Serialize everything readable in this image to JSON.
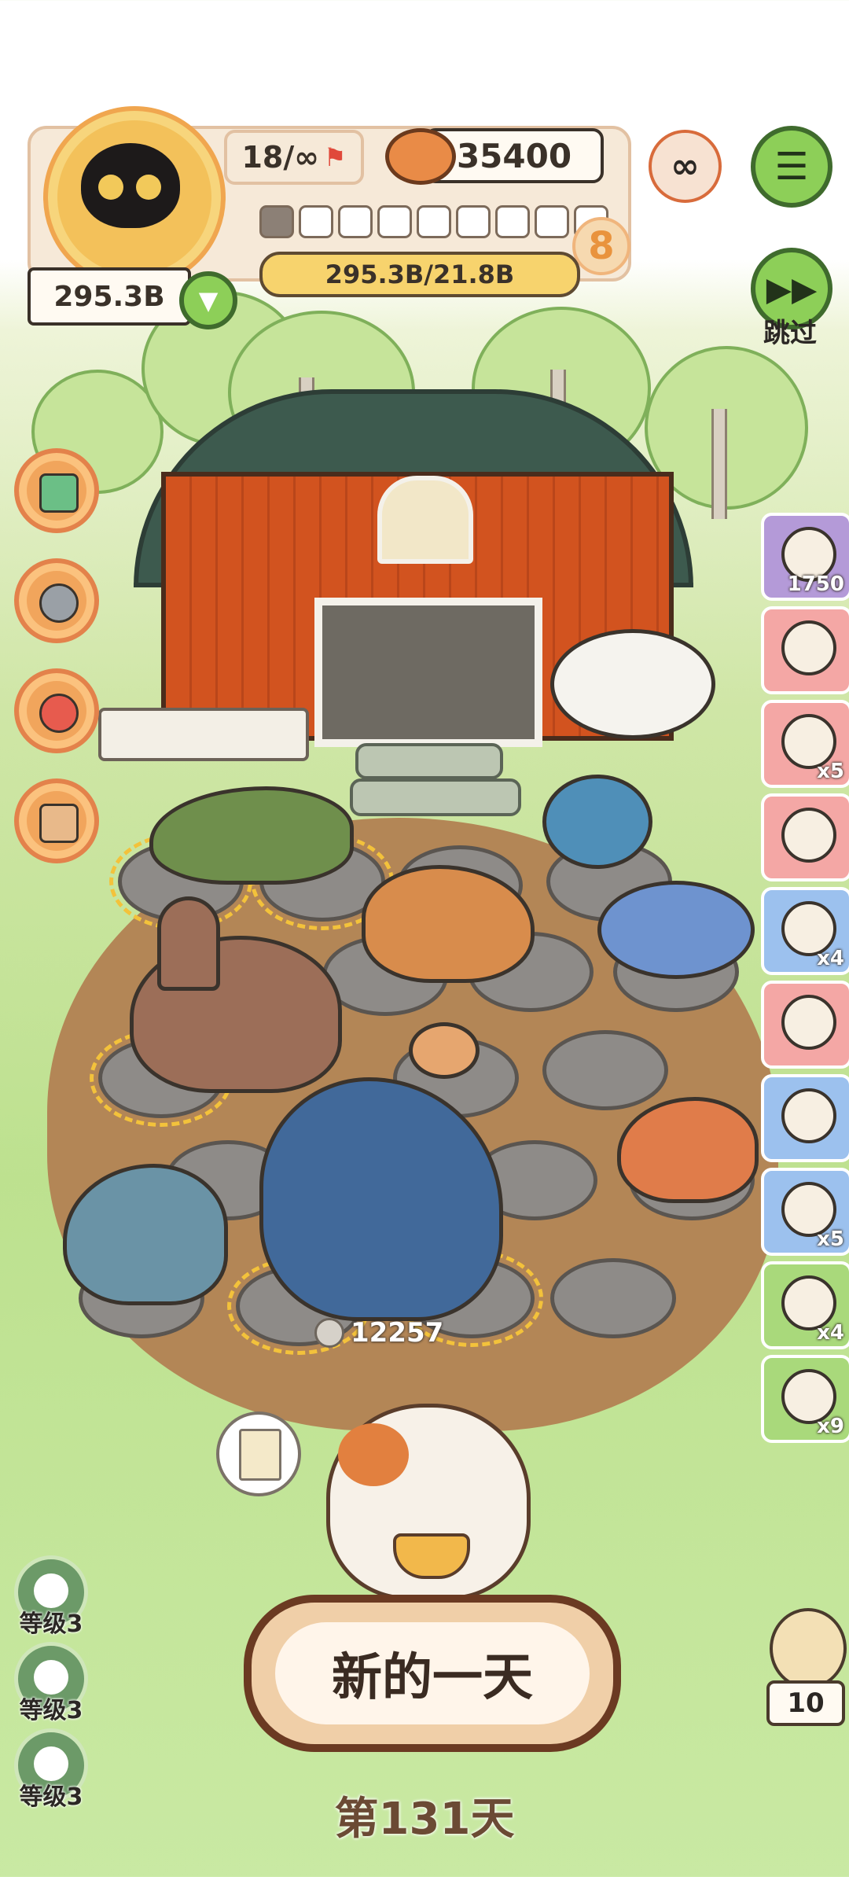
{
  "hud": {
    "population": "18/∞",
    "coins": "35400",
    "level": "8",
    "progress_text": "295.3B/21.8B",
    "progress_segments_filled": 1,
    "progress_segments_total": 9,
    "currency": "295.3B"
  },
  "skip": {
    "label": "跳过"
  },
  "fossil_counter": "12257",
  "right_items": [
    {
      "name": "fossil-shop",
      "badge": "1750",
      "color": "#b49ad8"
    },
    {
      "name": "skeleton-item",
      "badge": "",
      "color": "#f4a7a5"
    },
    {
      "name": "bag-item",
      "badge": "x5",
      "color": "#f4a7a5"
    },
    {
      "name": "paw-plus-item",
      "badge": "",
      "color": "#f4a7a5"
    },
    {
      "name": "donut-item",
      "badge": "x4",
      "color": "#9cc1ee"
    },
    {
      "name": "potion-item",
      "badge": "",
      "color": "#f4a7a5"
    },
    {
      "name": "jar-item",
      "badge": "",
      "color": "#9cc1ee"
    },
    {
      "name": "can-item",
      "badge": "x5",
      "color": "#9cc1ee"
    },
    {
      "name": "tent-item",
      "badge": "x4",
      "color": "#a9d97b"
    },
    {
      "name": "ticket-item",
      "badge": "x9",
      "color": "#a9d97b"
    }
  ],
  "skills": [
    {
      "label": "等级3"
    },
    {
      "label": "等级3"
    },
    {
      "label": "等级3"
    }
  ],
  "new_day_button": "新的一天",
  "day_label": "第131天",
  "egg_counter": "10",
  "colors": {
    "accent_green": "#8dcf58",
    "hud_orange": "#f0a64f",
    "progress_yellow": "#f7d36d"
  }
}
